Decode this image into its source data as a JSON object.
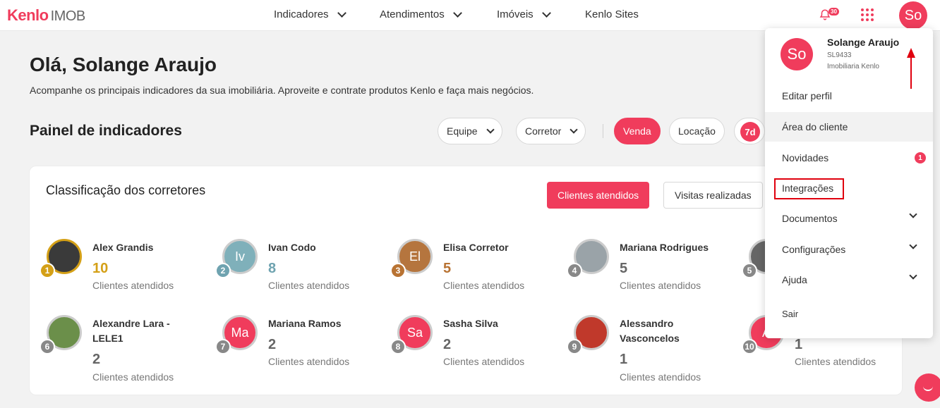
{
  "header": {
    "logo_brand": "Kenlo",
    "logo_sub": "IMOB",
    "nav": [
      "Indicadores",
      "Atendimentos",
      "Imóveis",
      "Kenlo Sites"
    ],
    "bell_count": "30",
    "avatar_initials": "So"
  },
  "greeting": {
    "title": "Olá, Solange Araujo",
    "subtitle": "Acompanhe os principais indicadores da sua imobiliária. Aproveite e contrate produtos Kenlo e faça mais negócios."
  },
  "panel": {
    "title": "Painel de indicadores",
    "filters": [
      "Equipe",
      "Corretor",
      "Venda",
      "Locação"
    ],
    "period_badge": "7d"
  },
  "card": {
    "title": "Classificação dos corretores",
    "buttons": [
      "Clientes atendidos",
      "Visitas realizadas"
    ],
    "brokers": [
      {
        "rank": "1",
        "name": "Alex Grandis",
        "count": "10",
        "label": "Clientes atendidos",
        "initials": "",
        "color": "#d4a017"
      },
      {
        "rank": "2",
        "name": "Ivan Codo",
        "count": "8",
        "label": "Clientes atendidos",
        "initials": "Iv",
        "color": "#6fa3b0"
      },
      {
        "rank": "3",
        "name": "Elisa Corretor",
        "count": "5",
        "label": "Clientes atendidos",
        "initials": "El",
        "color": "#b87333"
      },
      {
        "rank": "4",
        "name": "Mariana Rodrigues",
        "count": "5",
        "label": "Clientes atendidos",
        "initials": "",
        "color": "#888888"
      },
      {
        "rank": "5",
        "name": "",
        "count": "",
        "label": "",
        "initials": "",
        "color": "#888888"
      },
      {
        "rank": "6",
        "name": "Alexandre Lara - LELE1",
        "count": "2",
        "label": "Clientes atendidos",
        "initials": "",
        "color": "#888888"
      },
      {
        "rank": "7",
        "name": "Mariana Ramos",
        "count": "2",
        "label": "Clientes atendidos",
        "initials": "Ma",
        "color": "#888888"
      },
      {
        "rank": "8",
        "name": "Sasha Silva",
        "count": "2",
        "label": "Clientes atendidos",
        "initials": "Sa",
        "color": "#888888"
      },
      {
        "rank": "9",
        "name": "Alessandro Vasconcelos",
        "count": "1",
        "label": "Clientes atendidos",
        "initials": "",
        "color": "#888888"
      },
      {
        "rank": "10",
        "name": "",
        "count": "1",
        "label": "Clientes atendidos",
        "initials": "A",
        "color": "#888888"
      }
    ]
  },
  "dropdown": {
    "avatar_initials": "So",
    "name": "Solange Araujo",
    "code": "SL9433",
    "company": "Imobiliaria Kenlo",
    "items": [
      "Editar perfil",
      "Área do cliente",
      "Novidades",
      "Integrações",
      "Documentos",
      "Configurações",
      "Ajuda",
      "Sair"
    ],
    "news_badge": "1"
  },
  "colors": {
    "accent": "#f03c5c",
    "annotation": "#e0000e"
  }
}
